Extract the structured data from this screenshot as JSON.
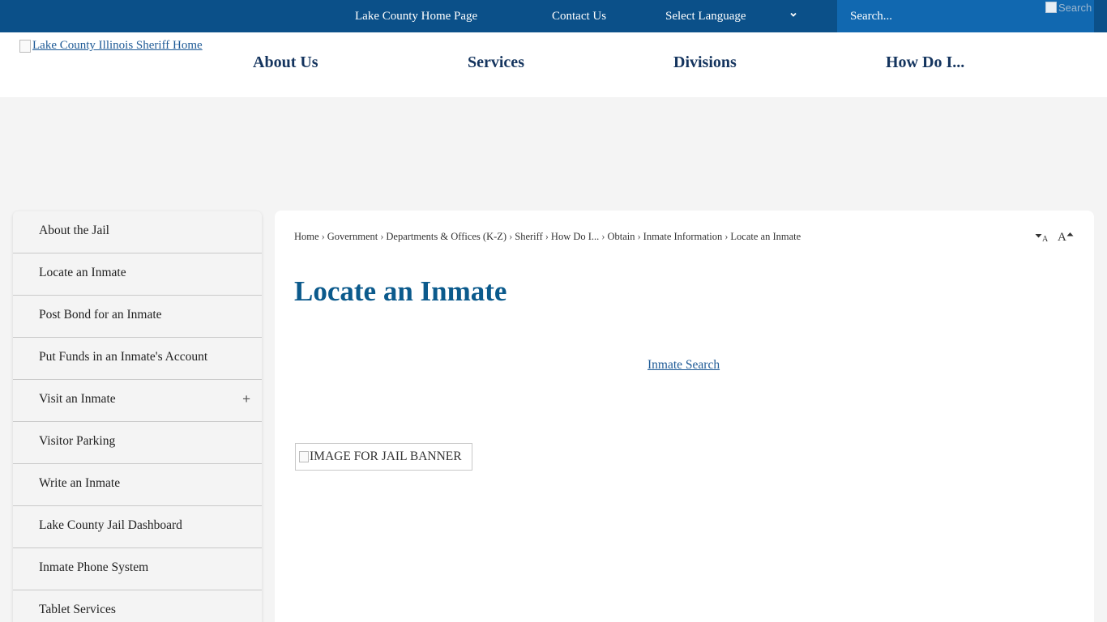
{
  "topbar": {
    "home_link": "Lake County Home Page",
    "contact_link": "Contact Us",
    "language_label": "Select Language",
    "search_placeholder": "Search...",
    "search_button_alt": "Search"
  },
  "header": {
    "logo_alt": "Lake County Illinois Sheriff Home",
    "nav": [
      "About Us",
      "Services",
      "Divisions",
      "How Do I..."
    ]
  },
  "sidebar": {
    "items": [
      {
        "label": "About the Jail",
        "expandable": false
      },
      {
        "label": "Locate an Inmate",
        "expandable": false
      },
      {
        "label": "Post Bond for an Inmate",
        "expandable": false
      },
      {
        "label": "Put Funds in an Inmate's Account",
        "expandable": false
      },
      {
        "label": "Visit an Inmate",
        "expandable": true
      },
      {
        "label": "Visitor Parking",
        "expandable": false
      },
      {
        "label": "Write an Inmate",
        "expandable": false
      },
      {
        "label": "Lake County Jail Dashboard",
        "expandable": false
      },
      {
        "label": "Inmate Phone System",
        "expandable": false
      },
      {
        "label": "Tablet Services",
        "expandable": false
      }
    ],
    "expand_symbol": "+"
  },
  "content": {
    "breadcrumb": [
      "Home",
      "Government",
      "Departments & Offices (K-Z)",
      "Sheriff",
      "How Do I...",
      "Obtain",
      "Inmate Information",
      "Locate an Inmate"
    ],
    "breadcrumb_separator": "›",
    "font_size_letter": "A",
    "title": "Locate an Inmate",
    "inmate_search_link": "Inmate Search",
    "banner_alt": "IMAGE FOR JAIL BANNER"
  },
  "colors": {
    "topbar_bg": "#0b5089",
    "search_bg": "#1168b0",
    "nav_text": "#14345e",
    "title_text": "#0b5a8c",
    "link": "#1e5a96"
  },
  "icons": {
    "language_dropdown": "chevron-down-icon",
    "decrease_font": "caret-down-icon",
    "increase_font": "caret-up-icon",
    "expand": "plus-icon"
  }
}
